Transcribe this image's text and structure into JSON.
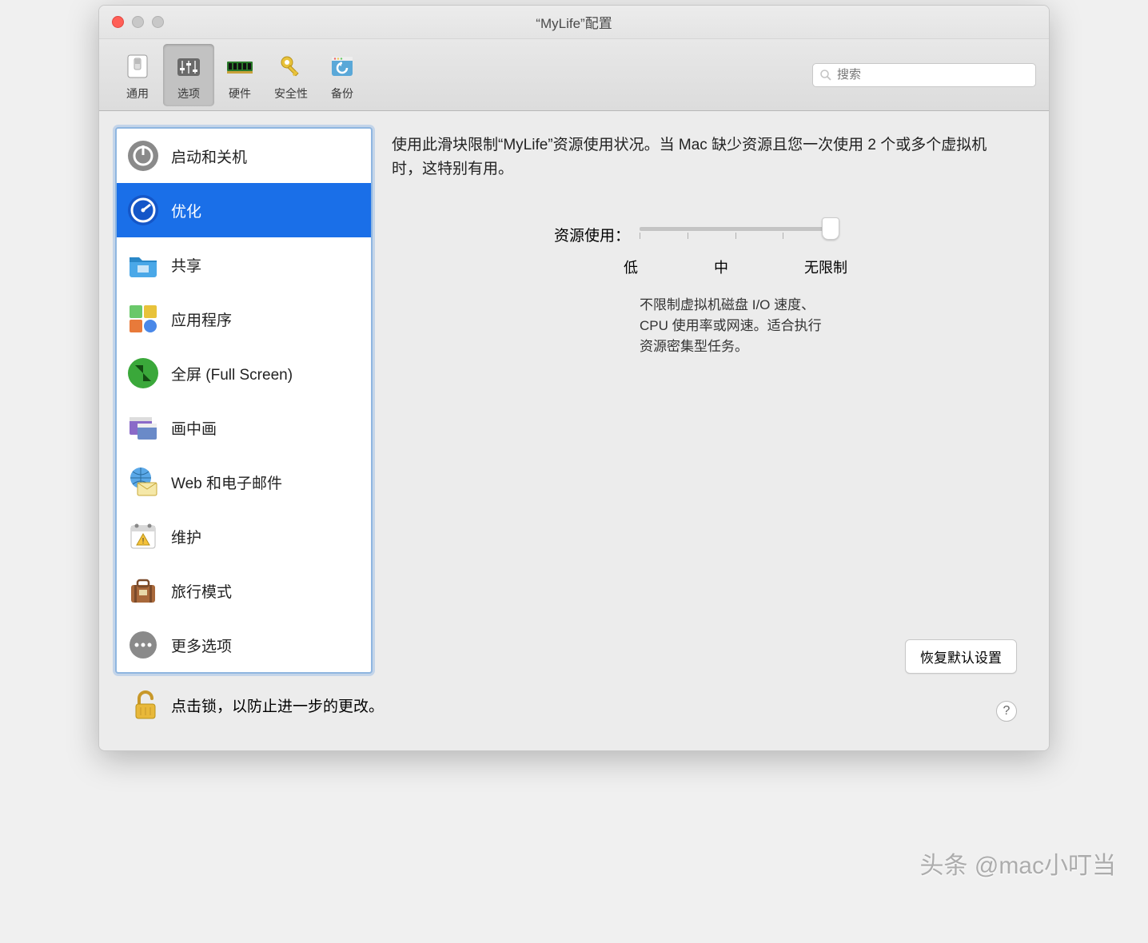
{
  "window": {
    "title": "“MyLife”配置"
  },
  "search": {
    "placeholder": "搜索"
  },
  "toolbar": {
    "items": [
      {
        "label": "通用"
      },
      {
        "label": "选项"
      },
      {
        "label": "硬件"
      },
      {
        "label": "安全性"
      },
      {
        "label": "备份"
      }
    ],
    "selected": 1
  },
  "sidebar": {
    "items": [
      {
        "label": "启动和关机"
      },
      {
        "label": "优化"
      },
      {
        "label": "共享"
      },
      {
        "label": "应用程序"
      },
      {
        "label": "全屏 (Full Screen)"
      },
      {
        "label": "画中画"
      },
      {
        "label": "Web 和电子邮件"
      },
      {
        "label": "维护"
      },
      {
        "label": "旅行模式"
      },
      {
        "label": "更多选项"
      }
    ],
    "selected": 1
  },
  "main": {
    "description": "使用此滑块限制“MyLife”资源使用状况。当 Mac 缺少资源且您一次使用 2 个或多个虚拟机时，这特别有用。",
    "slider_label": "资源使用：",
    "marks": {
      "low": "低",
      "mid": "中",
      "high": "无限制"
    },
    "explanation": "不限制虚拟机磁盘 I/O 速度、CPU 使用率或网速。适合执行资源密集型任务。",
    "restore_label": "恢复默认设置"
  },
  "footer": {
    "text": "点击锁，以防止进一步的更改。"
  },
  "watermark": "头条 @mac小叮当"
}
